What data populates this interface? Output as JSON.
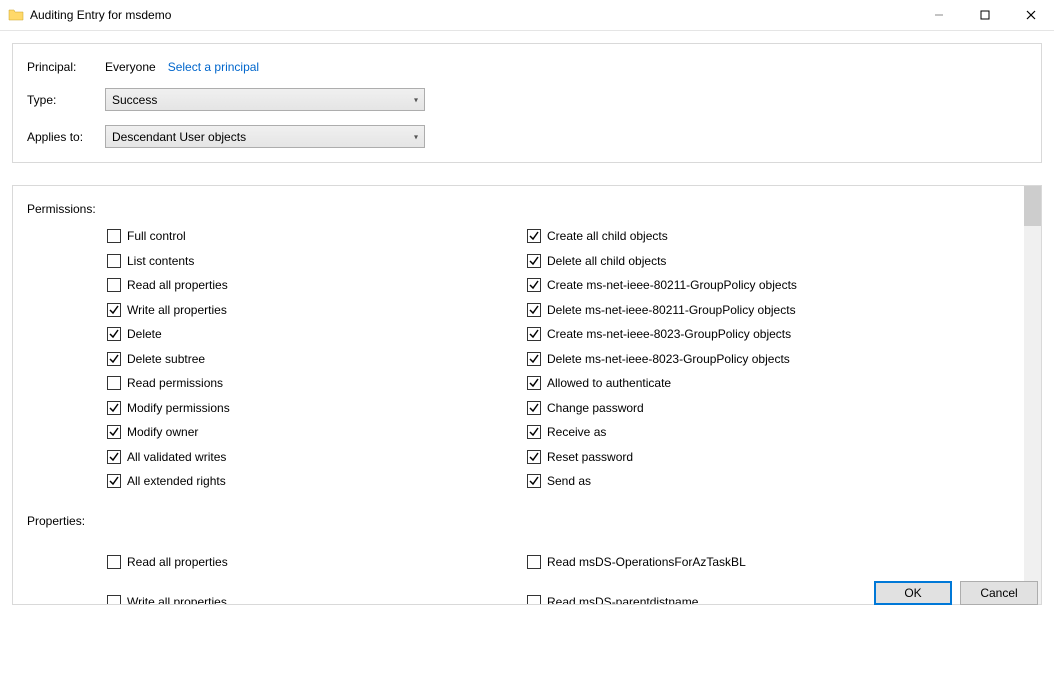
{
  "title": "Auditing Entry for msdemo",
  "labels": {
    "principal": "Principal:",
    "type": "Type:",
    "applies": "Applies to:",
    "permissions": "Permissions:",
    "properties": "Properties:"
  },
  "principal_value": "Everyone",
  "select_principal": "Select a principal",
  "type_value": "Success",
  "applies_value": "Descendant User objects",
  "perm_left": [
    {
      "label": "Full control",
      "checked": false
    },
    {
      "label": "List contents",
      "checked": false
    },
    {
      "label": "Read all properties",
      "checked": false
    },
    {
      "label": "Write all properties",
      "checked": true
    },
    {
      "label": "Delete",
      "checked": true
    },
    {
      "label": "Delete subtree",
      "checked": true
    },
    {
      "label": "Read permissions",
      "checked": false
    },
    {
      "label": "Modify permissions",
      "checked": true
    },
    {
      "label": "Modify owner",
      "checked": true
    },
    {
      "label": "All validated writes",
      "checked": true
    },
    {
      "label": "All extended rights",
      "checked": true
    }
  ],
  "perm_right": [
    {
      "label": "Create all child objects",
      "checked": true
    },
    {
      "label": "Delete all child objects",
      "checked": true
    },
    {
      "label": "Create ms-net-ieee-80211-GroupPolicy objects",
      "checked": true
    },
    {
      "label": "Delete ms-net-ieee-80211-GroupPolicy objects",
      "checked": true
    },
    {
      "label": "Create ms-net-ieee-8023-GroupPolicy objects",
      "checked": true
    },
    {
      "label": "Delete ms-net-ieee-8023-GroupPolicy objects",
      "checked": true
    },
    {
      "label": "Allowed to authenticate",
      "checked": true
    },
    {
      "label": "Change password",
      "checked": true
    },
    {
      "label": "Receive as",
      "checked": true
    },
    {
      "label": "Reset password",
      "checked": true
    },
    {
      "label": "Send as",
      "checked": true
    }
  ],
  "prop_left": [
    {
      "label": "Read all properties",
      "checked": false
    },
    {
      "label": "Write all properties",
      "checked": false
    }
  ],
  "prop_right": [
    {
      "label": "Read msDS-OperationsForAzTaskBL",
      "checked": false
    },
    {
      "label": "Read msDS-parentdistname",
      "checked": false
    }
  ],
  "buttons": {
    "ok": "OK",
    "cancel": "Cancel"
  }
}
